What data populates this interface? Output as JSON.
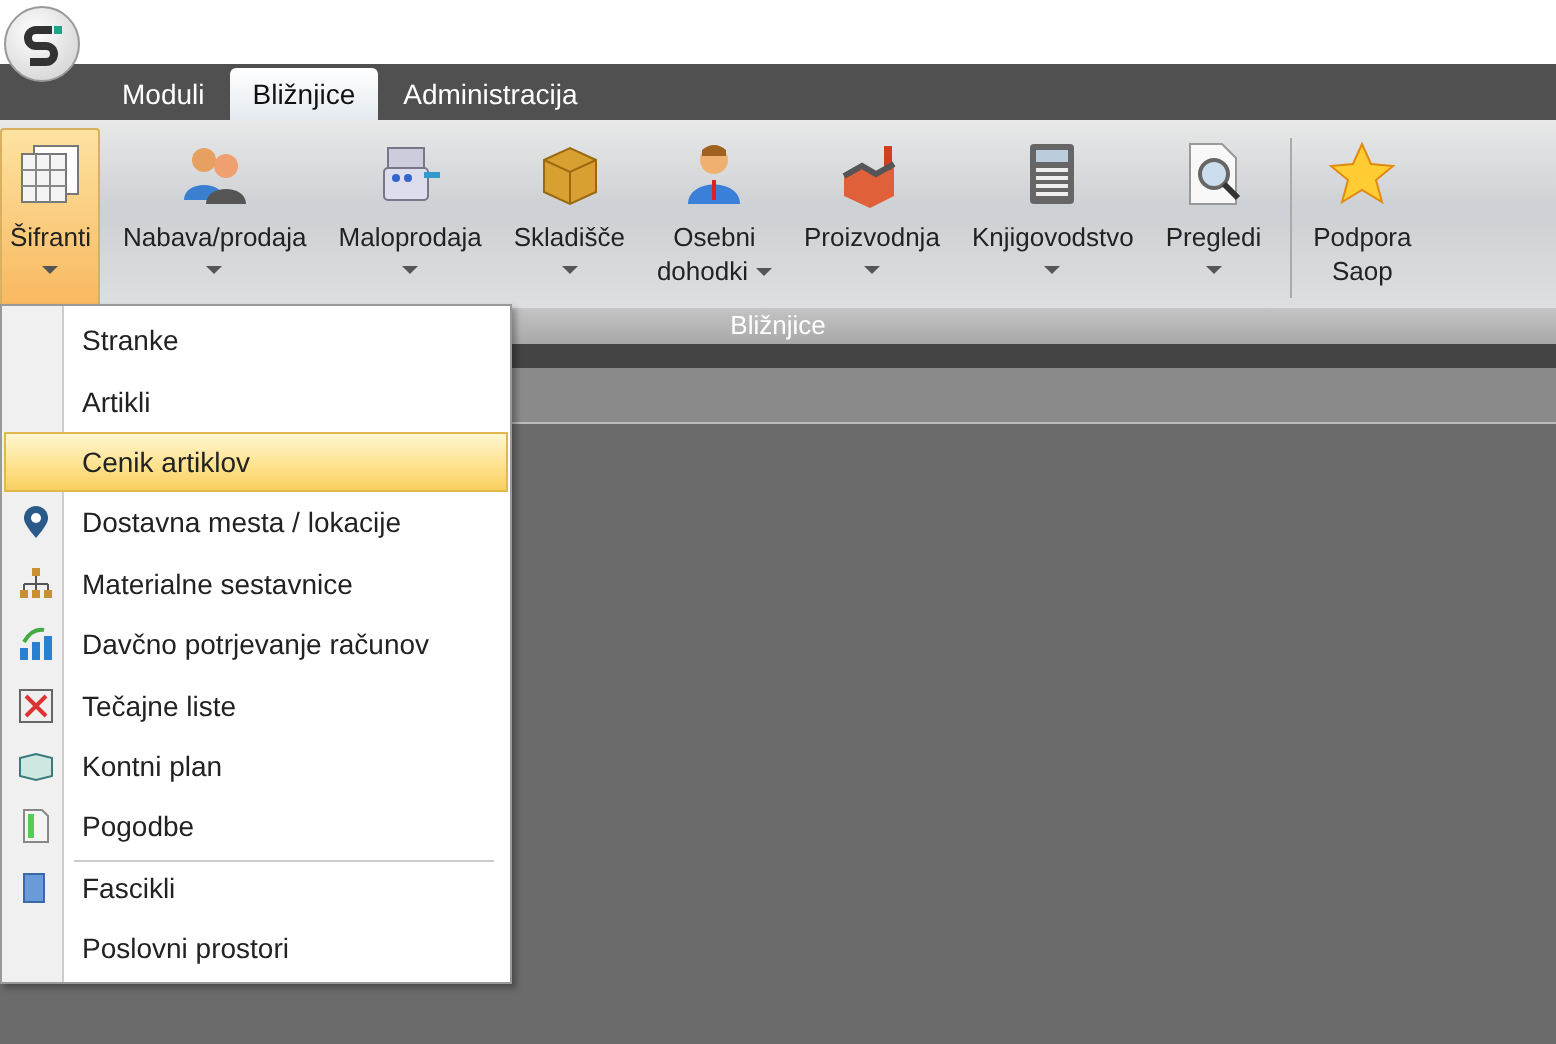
{
  "tabs": [
    {
      "label": "Moduli",
      "selected": false
    },
    {
      "label": "Bližnjice",
      "selected": true
    },
    {
      "label": "Administracija",
      "selected": false
    }
  ],
  "ribbon": {
    "group_label": "Bližnjice",
    "buttons": [
      {
        "lines": [
          "Šifranti"
        ],
        "dropdown": true,
        "pressed": true,
        "separator_before": false
      },
      {
        "lines": [
          "Nabava/prodaja"
        ],
        "dropdown": true,
        "pressed": false,
        "separator_before": false
      },
      {
        "lines": [
          "Maloprodaja"
        ],
        "dropdown": true,
        "pressed": false,
        "separator_before": false
      },
      {
        "lines": [
          "Skladišče"
        ],
        "dropdown": true,
        "pressed": false,
        "separator_before": false
      },
      {
        "lines": [
          "Osebni",
          "dohodki"
        ],
        "dropdown": true,
        "pressed": false,
        "separator_before": false
      },
      {
        "lines": [
          "Proizvodnja"
        ],
        "dropdown": true,
        "pressed": false,
        "separator_before": false
      },
      {
        "lines": [
          "Knjigovodstvo"
        ],
        "dropdown": true,
        "pressed": false,
        "separator_before": false
      },
      {
        "lines": [
          "Pregledi"
        ],
        "dropdown": true,
        "pressed": false,
        "separator_before": false
      },
      {
        "lines": [
          "Podpora",
          "Saop"
        ],
        "dropdown": false,
        "pressed": false,
        "separator_before": true
      }
    ]
  },
  "menu": {
    "items": [
      {
        "label": "Stranke",
        "icon": false,
        "selected": false,
        "separator_before": false
      },
      {
        "label": "Artikli",
        "icon": false,
        "selected": false,
        "separator_before": false
      },
      {
        "label": "Cenik artiklov",
        "icon": false,
        "selected": true,
        "separator_before": false
      },
      {
        "label": "Dostavna mesta / lokacije",
        "icon": true,
        "selected": false,
        "separator_before": false
      },
      {
        "label": "Materialne sestavnice",
        "icon": true,
        "selected": false,
        "separator_before": false
      },
      {
        "label": "Davčno potrjevanje računov",
        "icon": true,
        "selected": false,
        "separator_before": false
      },
      {
        "label": "Tečajne liste",
        "icon": true,
        "selected": false,
        "separator_before": false
      },
      {
        "label": "Kontni plan",
        "icon": true,
        "selected": false,
        "separator_before": false
      },
      {
        "label": "Pogodbe",
        "icon": true,
        "selected": false,
        "separator_before": false
      },
      {
        "label": "Fascikli",
        "icon": true,
        "selected": false,
        "separator_before": true
      },
      {
        "label": "Poslovni prostori",
        "icon": false,
        "selected": false,
        "separator_before": false
      }
    ]
  }
}
